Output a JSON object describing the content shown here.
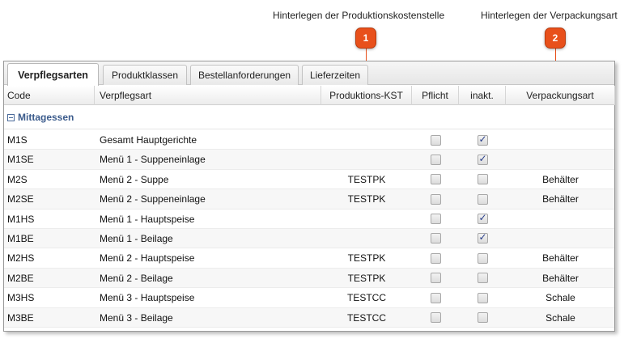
{
  "callouts": [
    {
      "number": "1",
      "text": "Hinterlegen der Produktionskostenstelle"
    },
    {
      "number": "2",
      "text": "Hinterlegen der Verpackungsart"
    }
  ],
  "tabs": [
    {
      "label": "Verpflegsarten",
      "active": true
    },
    {
      "label": "Produktklassen",
      "active": false
    },
    {
      "label": "Bestellanforderungen",
      "active": false
    },
    {
      "label": "Lieferzeiten",
      "active": false
    }
  ],
  "columns": {
    "code": "Code",
    "verpflegsart": "Verpflegsart",
    "produktions_kst": "Produktions-KST",
    "pflicht": "Pflicht",
    "inakt": "inakt.",
    "verpackungsart": "Verpackungsart"
  },
  "group": {
    "label": "Mittagessen",
    "toggle": "minus-icon"
  },
  "rows": [
    {
      "code": "M1S",
      "name": "Gesamt Hauptgerichte",
      "kst": "",
      "pflicht": false,
      "inakt": true,
      "verpackung": ""
    },
    {
      "code": "M1SE",
      "name": "Menü 1 - Suppeneinlage",
      "kst": "",
      "pflicht": false,
      "inakt": true,
      "verpackung": ""
    },
    {
      "code": "M2S",
      "name": "Menü 2 - Suppe",
      "kst": "TESTPK",
      "pflicht": false,
      "inakt": false,
      "verpackung": "Behälter"
    },
    {
      "code": "M2SE",
      "name": "Menü 2 - Suppeneinlage",
      "kst": "TESTPK",
      "pflicht": false,
      "inakt": false,
      "verpackung": "Behälter"
    },
    {
      "code": "M1HS",
      "name": "Menü 1 - Hauptspeise",
      "kst": "",
      "pflicht": false,
      "inakt": true,
      "verpackung": ""
    },
    {
      "code": "M1BE",
      "name": "Menü 1 - Beilage",
      "kst": "",
      "pflicht": false,
      "inakt": true,
      "verpackung": ""
    },
    {
      "code": "M2HS",
      "name": "Menü 2 - Hauptspeise",
      "kst": "TESTPK",
      "pflicht": false,
      "inakt": false,
      "verpackung": "Behälter"
    },
    {
      "code": "M2BE",
      "name": "Menü 2 - Beilage",
      "kst": "TESTPK",
      "pflicht": false,
      "inakt": false,
      "verpackung": "Behälter"
    },
    {
      "code": "M3HS",
      "name": "Menü 3 - Hauptspeise",
      "kst": "TESTCC",
      "pflicht": false,
      "inakt": false,
      "verpackung": "Schale"
    },
    {
      "code": "M3BE",
      "name": "Menü 3 - Beilage",
      "kst": "TESTCC",
      "pflicht": false,
      "inakt": false,
      "verpackung": "Schale"
    }
  ],
  "colors": {
    "marker": "#e8501b",
    "group_label": "#3b5b8c"
  }
}
